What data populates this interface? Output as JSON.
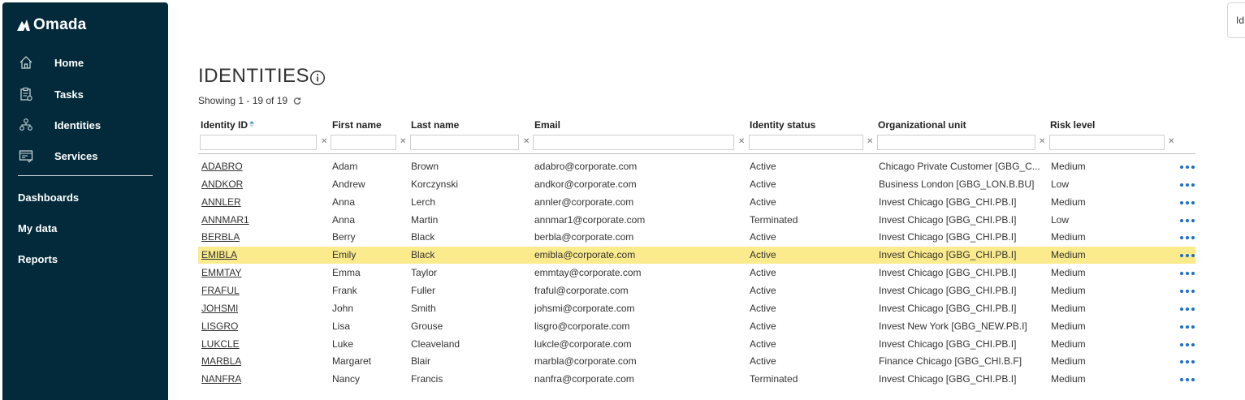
{
  "app": {
    "name": "Omada"
  },
  "sidebar": {
    "items": [
      {
        "label": "Home",
        "icon": "home-icon"
      },
      {
        "label": "Tasks",
        "icon": "tasks-icon"
      },
      {
        "label": "Identities",
        "icon": "identities-icon"
      },
      {
        "label": "Services",
        "icon": "services-icon"
      }
    ],
    "links": [
      "Dashboards",
      "My data",
      "Reports"
    ]
  },
  "top_right": {
    "text": "Id"
  },
  "page": {
    "title": "IDENTITIES",
    "showing": "Showing 1 - 19 of 19"
  },
  "table": {
    "columns": [
      "Identity ID",
      "First name",
      "Last name",
      "Email",
      "Identity status",
      "Organizational unit",
      "Risk level"
    ],
    "rows": [
      [
        "ADABRO",
        "Adam",
        "Brown",
        "adabro@corporate.com",
        "Active",
        "Chicago Private Customer [GBG_C...",
        "Medium"
      ],
      [
        "ANDKOR",
        "Andrew",
        "Korczynski",
        "andkor@corporate.com",
        "Active",
        "Business London [GBG_LON.B.BU]",
        "Low"
      ],
      [
        "ANNLER",
        "Anna",
        "Lerch",
        "annler@corporate.com",
        "Active",
        "Invest Chicago [GBG_CHI.PB.I]",
        "Medium"
      ],
      [
        "ANNMAR1",
        "Anna",
        "Martin",
        "annmar1@corporate.com",
        "Terminated",
        "Invest Chicago [GBG_CHI.PB.I]",
        "Low"
      ],
      [
        "BERBLA",
        "Berry",
        "Black",
        "berbla@corporate.com",
        "Active",
        "Invest Chicago [GBG_CHI.PB.I]",
        "Medium"
      ],
      [
        "EMIBLA",
        "Emily",
        "Black",
        "emibla@corporate.com",
        "Active",
        "Invest Chicago [GBG_CHI.PB.I]",
        "Medium"
      ],
      [
        "EMMTAY",
        "Emma",
        "Taylor",
        "emmtay@corporate.com",
        "Active",
        "Invest Chicago [GBG_CHI.PB.I]",
        "Medium"
      ],
      [
        "FRAFUL",
        "Frank",
        "Fuller",
        "fraful@corporate.com",
        "Active",
        "Invest Chicago [GBG_CHI.PB.I]",
        "Medium"
      ],
      [
        "JOHSMI",
        "John",
        "Smith",
        "johsmi@corporate.com",
        "Active",
        "Invest Chicago [GBG_CHI.PB.I]",
        "Medium"
      ],
      [
        "LISGRO",
        "Lisa",
        "Grouse",
        "lisgro@corporate.com",
        "Active",
        "Invest New York [GBG_NEW.PB.I]",
        "Medium"
      ],
      [
        "LUKCLE",
        "Luke",
        "Cleaveland",
        "lukcle@corporate.com",
        "Active",
        "Invest Chicago [GBG_CHI.PB.I]",
        "Medium"
      ],
      [
        "MARBLA",
        "Margaret",
        "Blair",
        "marbla@corporate.com",
        "Active",
        "Finance Chicago [GBG_CHI.B.F]",
        "Medium"
      ],
      [
        "NANFRA",
        "Nancy",
        "Francis",
        "nanfra@corporate.com",
        "Terminated",
        "Invest Chicago [GBG_CHI.PB.I]",
        "Medium"
      ]
    ],
    "highlighted_row": "EMIBLA"
  },
  "colors": {
    "sidebar_bg": "#022a3a",
    "highlight": "#fbeb8c",
    "action_dots": "#1e6ec8"
  }
}
